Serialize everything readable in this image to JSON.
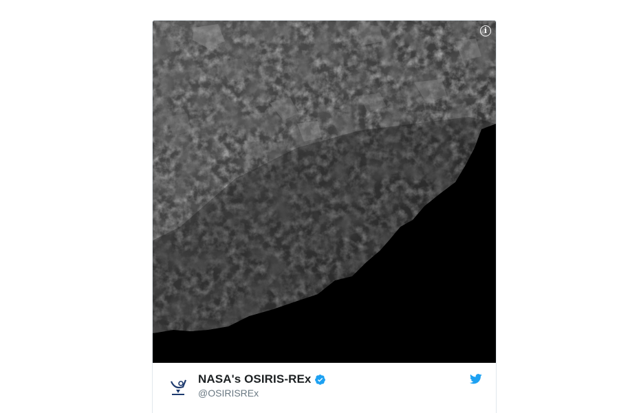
{
  "tweet": {
    "media": {
      "alt_icon": "info-icon",
      "info_glyph": "i"
    },
    "author": {
      "display_name": "NASA's OSIRIS-REx",
      "handle": "@OSIRISREx",
      "verified": true,
      "avatar_icon": "osiris-rex-logo-icon"
    },
    "brand_icon": "twitter-bird-icon",
    "colors": {
      "twitter_blue": "#1da1f2",
      "name_text": "#1c2022",
      "handle_text": "#697882",
      "border": "#e1e8ed"
    }
  }
}
